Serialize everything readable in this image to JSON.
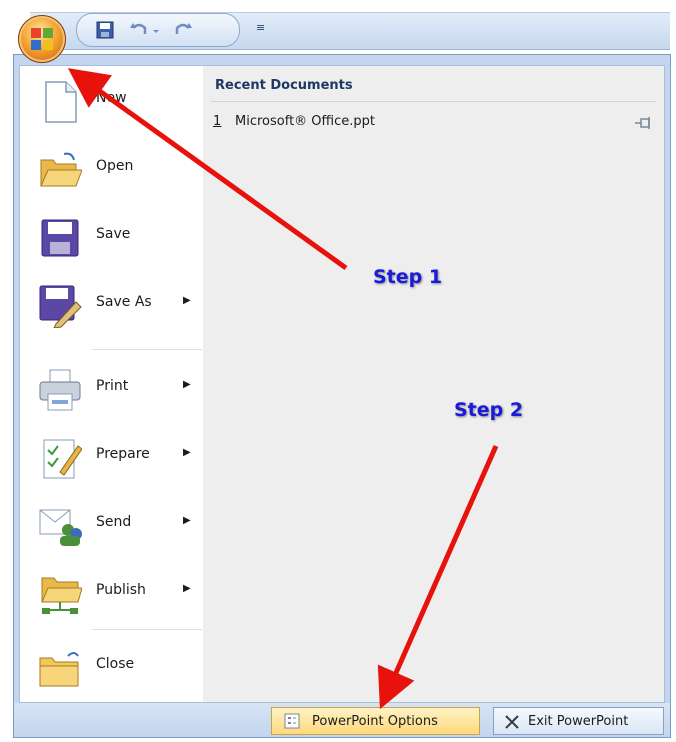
{
  "quick_access": {
    "icons": [
      "save-icon",
      "undo-icon",
      "undo-dropdown-icon",
      "redo-icon"
    ],
    "customize_symbol": "≡"
  },
  "office_button": {
    "icon": "office-logo-icon"
  },
  "menu": {
    "items": [
      {
        "label": "New",
        "icon": "new-document-icon",
        "arrow": ""
      },
      {
        "label": "Open",
        "icon": "open-folder-icon",
        "arrow": ""
      },
      {
        "label": "Save",
        "icon": "save-icon",
        "arrow": ""
      },
      {
        "label": "Save As",
        "icon": "save-as-icon",
        "arrow": "▶"
      },
      {
        "label": "Print",
        "icon": "printer-icon",
        "arrow": "▶"
      },
      {
        "label": "Prepare",
        "icon": "prepare-icon",
        "arrow": "▶"
      },
      {
        "label": "Send",
        "icon": "send-icon",
        "arrow": "▶"
      },
      {
        "label": "Publish",
        "icon": "publish-icon",
        "arrow": "▶"
      },
      {
        "label": "Close",
        "icon": "close-folder-icon",
        "arrow": ""
      }
    ]
  },
  "recent": {
    "title": "Recent Documents",
    "documents": [
      {
        "number": "1",
        "name": "Microsoft® Office.ppt",
        "icon": "pin-icon"
      }
    ]
  },
  "footer": {
    "options_label": "PowerPoint Options",
    "exit_label": "Exit PowerPoint"
  },
  "annotations": {
    "step1": "Step 1",
    "step2": "Step 2",
    "arrow_color": "#e8120c",
    "text_color": "#1a1ad8"
  }
}
